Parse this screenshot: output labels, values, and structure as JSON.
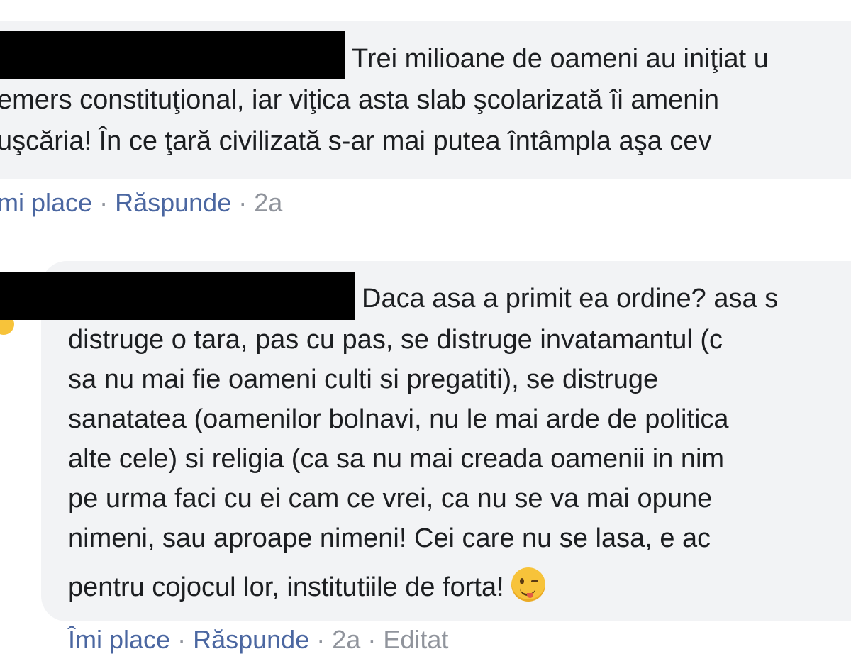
{
  "comments": [
    {
      "lines": [
        "Trei milioane de oameni au iniţiat u",
        "emers constituţional, iar viţica asta slab şcolarizată îi amenin",
        "uşcăria! În ce ţară civilizată s-ar mai putea întâmpla aşa cev"
      ],
      "actions": {
        "like_label": "mi place",
        "reply_label": "Răspunde",
        "time": "2a"
      }
    },
    {
      "lines": [
        "Daca asa a primit ea ordine? asa s",
        "distruge o tara, pas cu pas, se distruge invatamantul (c",
        "sa nu mai fie oameni culti si pregatiti), se distruge",
        "sanatatea (oamenilor bolnavi, nu le mai arde de politica",
        "alte cele) si religia (ca sa nu mai creada oamenii in nim",
        "pe urma faci cu ei cam ce vrei, ca nu se va mai opune",
        "nimeni, sau aproape nimeni! Cei care nu se lasa, e ac",
        "pentru cojocul lor, institutiile de forta!"
      ],
      "emoji": "winking-face-with-tongue-icon",
      "actions": {
        "like_label": "Îmi place",
        "reply_label": "Răspunde",
        "time": "2a",
        "edited_label": "Editat"
      }
    }
  ],
  "separator": "·",
  "colors": {
    "bubble_bg": "#f2f3f5",
    "text": "#1c1e21",
    "link": "#4b67a1",
    "meta": "#90949c",
    "redaction": "#000000"
  }
}
